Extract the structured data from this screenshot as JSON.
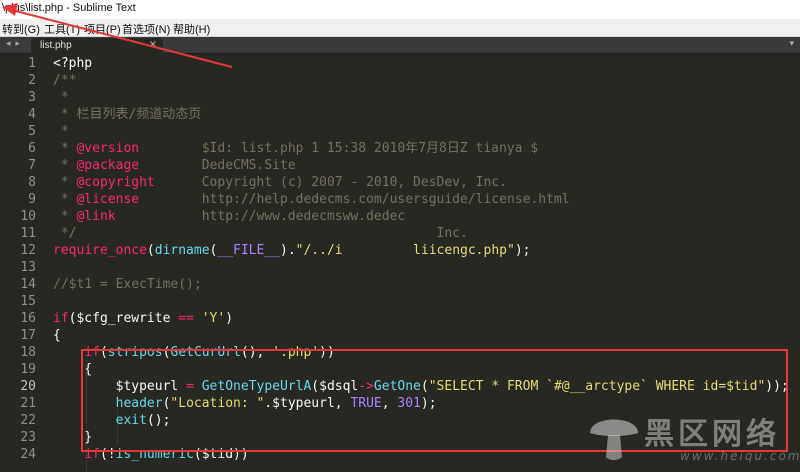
{
  "window": {
    "title": "\\plus\\list.php - Sublime Text"
  },
  "menu": {
    "items": [
      "转到(G)",
      "工具(T)",
      "项目(P)",
      "首选项(N)",
      "帮助(H)"
    ]
  },
  "tabs": {
    "nav_glyph": "◂ ▸",
    "active": {
      "label": "list.php",
      "close_glyph": "×"
    },
    "more_glyph": "▾"
  },
  "editor": {
    "lines": [
      {
        "n": "1",
        "text": "<?php"
      },
      {
        "n": "2",
        "text": "/**"
      },
      {
        "n": "3",
        "text": " *"
      },
      {
        "n": "4",
        "text": " * 栏目列表/频道动态页"
      },
      {
        "n": "5",
        "text": " *"
      },
      {
        "n": "6",
        "text": " * @version        $Id: list.php 1 15:38 2010年7月8日Z tianya $"
      },
      {
        "n": "7",
        "text": " * @package        DedeCMS.Site"
      },
      {
        "n": "8",
        "text": " * @copyright      Copyright (c) 2007 - 2010, DesDev, Inc."
      },
      {
        "n": "9",
        "text": " * @license        http://help.dedecms.com/usersguide/license.html"
      },
      {
        "n": "10",
        "text": " * @link           http://www.dedecmsww.dedec"
      },
      {
        "n": "11",
        "text": " */                                              Inc."
      },
      {
        "n": "12",
        "text": "require_once(dirname(__FILE__).\"/../i         liicengc.php\");"
      },
      {
        "n": "13",
        "text": ""
      },
      {
        "n": "14",
        "text": "//$t1 = ExecTime();"
      },
      {
        "n": "15",
        "text": ""
      },
      {
        "n": "16",
        "text": "if($cfg_rewrite == 'Y')"
      },
      {
        "n": "17",
        "text": "{"
      },
      {
        "n": "18",
        "text": "    if(stripos(GetCurUrl(), '.php'))"
      },
      {
        "n": "19",
        "text": "    {"
      },
      {
        "n": "20",
        "text": "        $typeurl = GetOneTypeUrlA($dsql->GetOne(\"SELECT * FROM `#@__arctype` WHERE id=$tid\"));"
      },
      {
        "n": "21",
        "text": "        header(\"Location: \".$typeurl, TRUE, 301);"
      },
      {
        "n": "22",
        "text": "        exit();"
      },
      {
        "n": "23",
        "text": "    }"
      },
      {
        "n": "24",
        "text": "    if(!is_numeric($tid))"
      }
    ]
  },
  "watermark": {
    "text": "黑区网络",
    "sub": "www.heiqu.com"
  },
  "colors": {
    "background": "#272822",
    "annotation": "#e5383b"
  }
}
